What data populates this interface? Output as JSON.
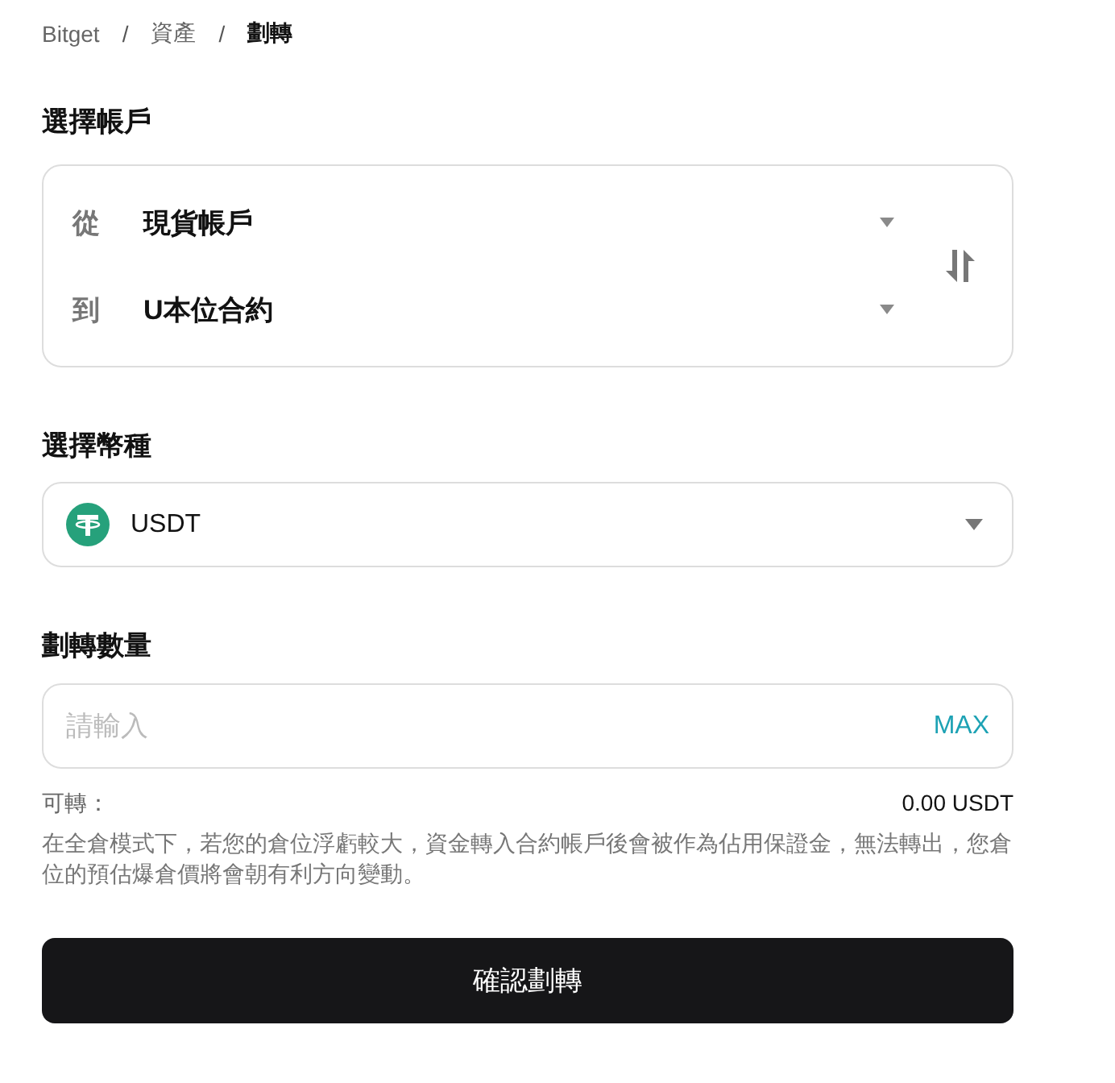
{
  "breadcrumb": {
    "separator": "/",
    "items": [
      {
        "label": "Bitget",
        "current": false
      },
      {
        "label": "資產",
        "current": false
      },
      {
        "label": "劃轉",
        "current": true
      }
    ]
  },
  "account_section": {
    "title": "選擇帳戶",
    "rows": [
      {
        "label": "從",
        "value": "現貨帳戶"
      },
      {
        "label": "到",
        "value": "U本位合約"
      }
    ]
  },
  "coin_section": {
    "title": "選擇幣種",
    "coin": "USDT"
  },
  "amount_section": {
    "title": "劃轉數量",
    "placeholder": "請輸入",
    "max_label": "MAX",
    "available_label": "可轉：",
    "available_value": "0.00 USDT",
    "note": "在全倉模式下，若您的倉位浮虧較大，資金轉入合約帳戶後會被作為佔用保證金，無法轉出，您倉位的預估爆倉價將會朝有利方向變動。"
  },
  "confirm_button": "確認劃轉"
}
